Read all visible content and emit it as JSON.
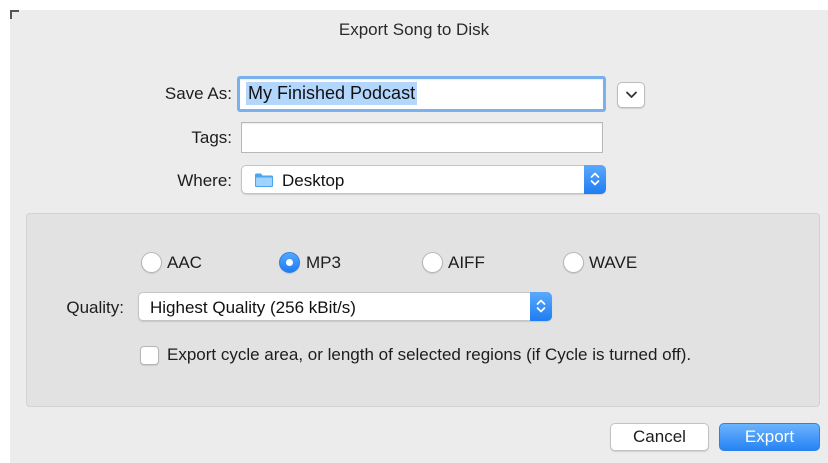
{
  "dialog": {
    "title": "Export Song to Disk"
  },
  "save_as": {
    "label": "Save As:",
    "value": "My Finished Podcast"
  },
  "tags": {
    "label": "Tags:",
    "value": ""
  },
  "where": {
    "label": "Where:",
    "value": "Desktop",
    "icon": "folder-icon"
  },
  "format": {
    "options": [
      {
        "label": "AAC",
        "checked": false
      },
      {
        "label": "MP3",
        "checked": true
      },
      {
        "label": "AIFF",
        "checked": false
      },
      {
        "label": "WAVE",
        "checked": false
      }
    ]
  },
  "quality": {
    "label": "Quality:",
    "value": "Highest Quality (256 kBit/s)"
  },
  "cycle_checkbox": {
    "label": "Export cycle area, or length of selected regions (if Cycle is turned off).",
    "checked": false
  },
  "buttons": {
    "cancel": "Cancel",
    "export": "Export"
  },
  "colors": {
    "accent": "#1f7cf2",
    "dialog_bg": "#ececec",
    "group_bg": "#e2e2e2",
    "focus_ring": "#7ab0ee",
    "selection": "#b3d6fd"
  }
}
